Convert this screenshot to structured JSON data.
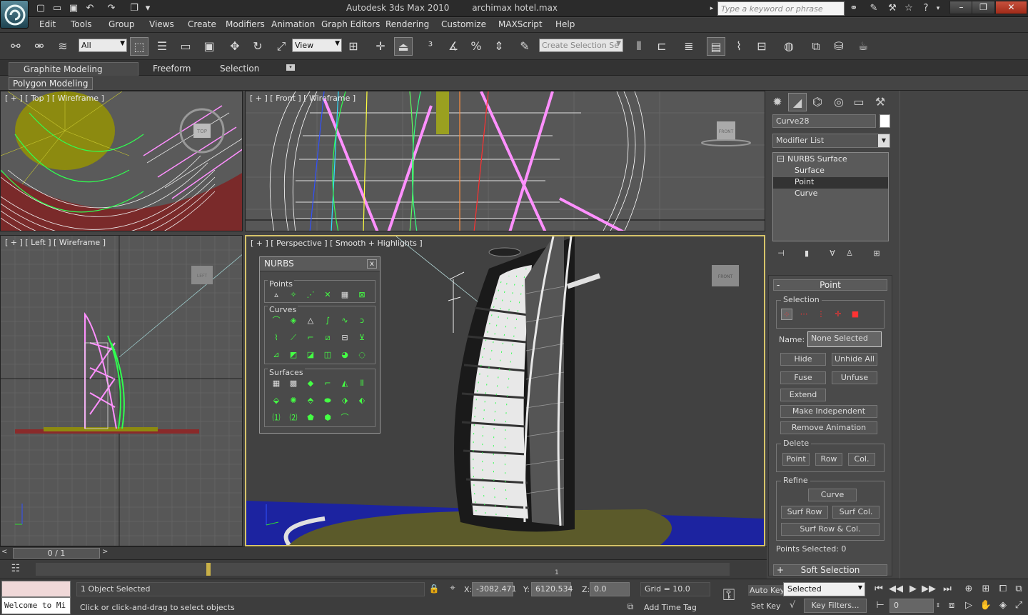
{
  "titlebar": {
    "app_name": "Autodesk 3ds Max  2010",
    "file_name": "archimax hotel.max",
    "search_placeholder": "Type a keyword or phrase"
  },
  "menubar": [
    "Edit",
    "Tools",
    "Group",
    "Views",
    "Create",
    "Modifiers",
    "Animation",
    "Graph Editors",
    "Rendering",
    "Customize",
    "MAXScript",
    "Help"
  ],
  "toolbar": {
    "selection_filter": "All",
    "reference_coord": "View",
    "named_selection": "Create Selection Se"
  },
  "ribbon": {
    "tabs": [
      "Graphite Modeling Tools",
      "Freeform",
      "Selection"
    ],
    "panel": "Polygon Modeling"
  },
  "viewports": {
    "top": "[ + ] [ Top ] [ Wireframe ]",
    "front": "[ + ] [ Front ] [ Wireframe ]",
    "left": "[ + ] [ Left ] [ Wireframe ]",
    "perspective": "[ + ] [ Perspective ] [ Smooth + Highlights ]",
    "cube_top": "TOP",
    "cube_front": "FRONT",
    "cube_left": "LEFT",
    "cube_persp": "FRONT"
  },
  "nurbs": {
    "title": "NURBS",
    "close": "x",
    "groups": [
      "Points",
      "Curves",
      "Surfaces"
    ]
  },
  "command_panel": {
    "object_name": "Curve28",
    "modifier_list": "Modifier List",
    "stack": [
      "NURBS Surface",
      "Surface",
      "Point",
      "Curve"
    ],
    "rollout_title": "Point",
    "selection_label": "Selection",
    "name_label": "Name:",
    "name_value": "None Selected",
    "buttons": {
      "hide": "Hide",
      "unhide_all": "Unhide All",
      "fuse": "Fuse",
      "unfuse": "Unfuse",
      "extend": "Extend",
      "make_independent": "Make Independent",
      "remove_animation": "Remove Animation"
    },
    "delete_label": "Delete",
    "delete_buttons": [
      "Point",
      "Row",
      "Col."
    ],
    "refine_label": "Refine",
    "refine_buttons": {
      "curve": "Curve",
      "surf_row": "Surf Row",
      "surf_col": "Surf Col.",
      "surf_row_col": "Surf Row & Col."
    },
    "points_selected": "Points Selected: 0",
    "soft_selection": "Soft Selection"
  },
  "timeline": {
    "frame": "0 / 1",
    "tick": "1"
  },
  "status": {
    "listener": "Welcome to Mi",
    "selected": "1 Object Selected",
    "prompt": "Click or click-and-drag to select objects",
    "x_label": "X:",
    "x_value": "-3082.471",
    "y_label": "Y:",
    "y_value": "6120.534",
    "z_label": "Z:",
    "z_value": "0.0",
    "grid": "Grid = 10.0",
    "add_time_tag": "Add Time Tag",
    "auto_key": "Auto Key",
    "set_key": "Set Key",
    "key_mode": "Selected",
    "key_filters": "Key Filters...",
    "frame_value": "0"
  }
}
